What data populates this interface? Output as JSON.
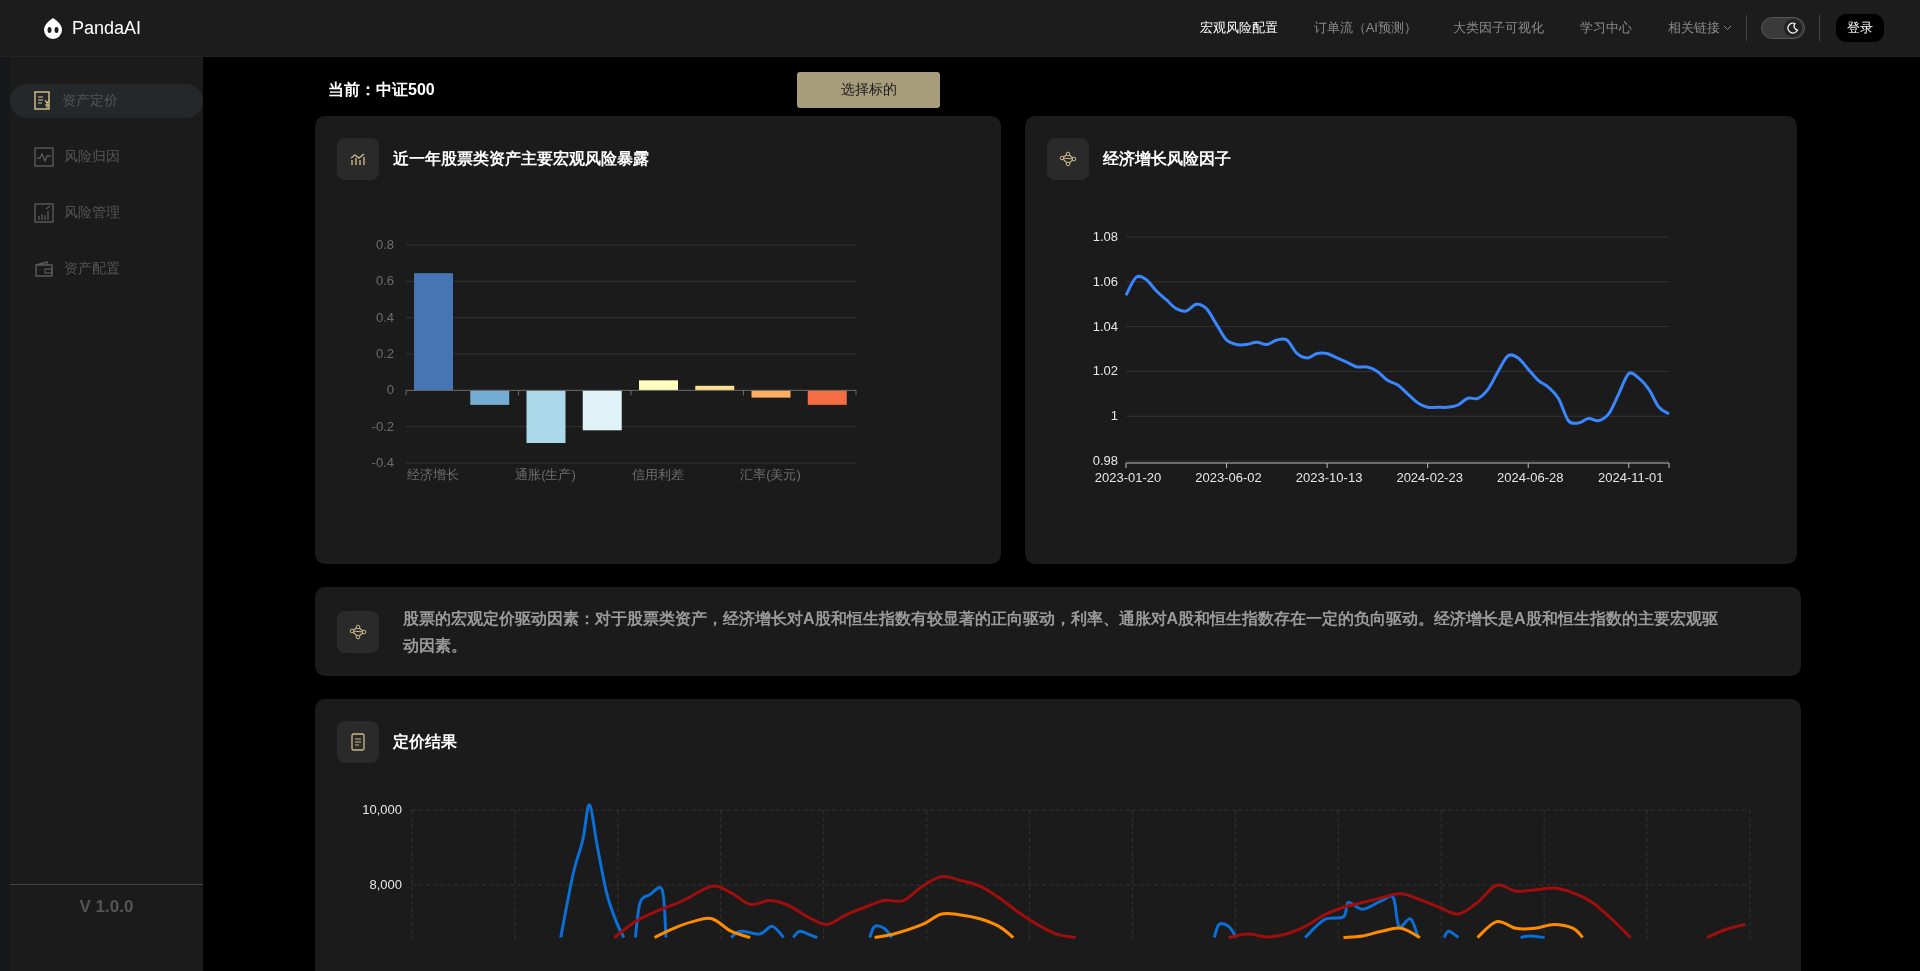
{
  "header": {
    "logo": "PandaAI",
    "nav": [
      {
        "label": "宏观风险配置",
        "selected": true,
        "kind": "link"
      },
      {
        "label": "订单流（AI预测）",
        "selected": false,
        "kind": "link"
      },
      {
        "label": "大类因子可视化",
        "selected": false,
        "kind": "link"
      },
      {
        "label": "学习中心",
        "selected": false,
        "kind": "link"
      },
      {
        "label": "相关链接",
        "selected": false,
        "kind": "dropdown"
      }
    ],
    "theme_toggle": {
      "on": true
    },
    "login_button": "登录"
  },
  "sidebar": {
    "items": [
      {
        "label": "资产定价",
        "selected": true
      },
      {
        "label": "风险归因",
        "selected": false
      },
      {
        "label": "风险管理",
        "selected": false
      },
      {
        "label": "资产配置",
        "selected": false
      }
    ],
    "version": "V 1.0.0"
  },
  "current": {
    "label": "当前：中证500",
    "button": "选择标的"
  },
  "exposure_card": {
    "title": "近一年股票类资产主要宏观风险暴露",
    "chart_data": {
      "type": "bar",
      "categories": [
        "经济增长",
        "通胀(生产)",
        "信用利差",
        "汇率(美元)"
      ],
      "series": [
        {
          "colors": [
            "#4575b4",
            "#abd9e9",
            "#ffffbf",
            "#fdae61"
          ],
          "values": [
            0.645,
            -0.29,
            0.055,
            -0.04
          ]
        },
        {
          "colors": [
            "#74add1",
            "#e0f3f8",
            "#fee090",
            "#f46d43"
          ],
          "values": [
            -0.08,
            -0.22,
            0.025,
            -0.08
          ]
        }
      ],
      "grid": true,
      "ylim": [
        -0.4,
        0.8
      ],
      "yticks": [
        {
          "value": 0.8,
          "label": "0.8"
        },
        {
          "value": 0.6,
          "label": "0.6"
        },
        {
          "value": 0.4,
          "label": "0.4"
        },
        {
          "value": 0.2,
          "label": "0.2"
        },
        {
          "value": 0,
          "label": "0"
        },
        {
          "value": -0.2,
          "label": "-0.2"
        },
        {
          "value": -0.4,
          "label": "-0.4"
        }
      ]
    }
  },
  "factor_card": {
    "title": "经济增长风险因子",
    "chart_data": {
      "type": "line",
      "grid": true,
      "ylim": [
        0.98,
        1.08
      ],
      "categories": [
        "2023-01-20",
        null,
        null,
        null,
        null,
        null,
        null,
        null,
        null,
        null,
        "2023-06-02",
        null,
        null,
        null,
        null,
        null,
        null,
        null,
        null,
        null,
        "2023-10-13",
        null,
        null,
        null,
        null,
        null,
        null,
        null,
        null,
        null,
        "2024-02-23",
        null,
        null,
        null,
        null,
        null,
        null,
        null,
        null,
        null,
        "2024-06-28",
        null,
        null,
        null,
        null,
        null,
        null,
        null,
        null,
        null,
        "2024-11-01",
        null,
        null,
        null,
        null
      ],
      "yticks": [
        {
          "value": 1.08,
          "label": "1.08"
        },
        {
          "value": 1.06,
          "label": "1.06"
        },
        {
          "value": 1.04,
          "label": "1.04"
        },
        {
          "value": 1.02,
          "label": "1.02"
        },
        {
          "value": 1,
          "label": "1"
        },
        {
          "value": 0.98,
          "label": "0.98"
        }
      ],
      "series": [
        {
          "color": "#3a86ff",
          "values": [
            1.054,
            1.062,
            1.061,
            1.056,
            1.052,
            1.048,
            1.047,
            1.05,
            1.048,
            1.041,
            1.034,
            1.032,
            1.032,
            1.033,
            1.032,
            1.034,
            1.034,
            1.028,
            1.026,
            1.028,
            1.028,
            1.026,
            1.024,
            1.022,
            1.022,
            1.02,
            1.016,
            1.014,
            1.01,
            1.006,
            1.004,
            1.004,
            1.004,
            1.005,
            1.008,
            1.008,
            1.012,
            1.02,
            1.027,
            1.026,
            1.021,
            1.016,
            1.013,
            1.008,
            0.998,
            0.997,
            0.999,
            0.998,
            1.001,
            1.01,
            1.019,
            1.017,
            1.012,
            1.004,
            1.001
          ]
        }
      ]
    }
  },
  "summary": {
    "text": "股票的宏观定价驱动因素：对于股票类资产，经济增长对A股和恒生指数有较显著的正向驱动，利率、通胀对A股和恒生指数存在一定的负向驱动。经济增长是A股和恒生指数的主要宏观驱动因素。"
  },
  "pricing_card": {
    "title": "定价结果",
    "y_tick_labels": [
      "10,000",
      "8,000"
    ]
  }
}
